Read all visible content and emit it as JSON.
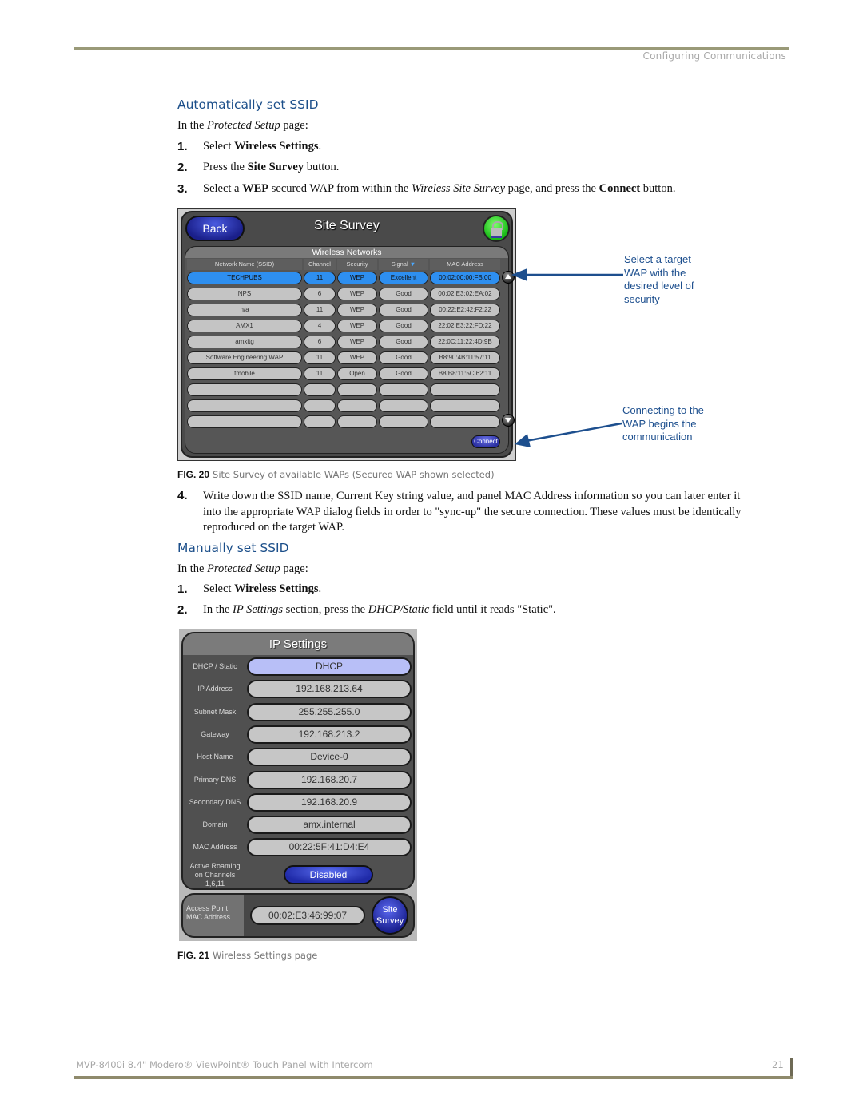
{
  "header": {
    "section": "Configuring Communications"
  },
  "auto": {
    "heading": "Automatically set SSID",
    "intro": {
      "pre": "In the ",
      "em": "Protected Setup",
      "post": " page:"
    },
    "steps": [
      {
        "num": "1.",
        "parts": [
          "Select ",
          "Wireless Settings",
          "."
        ]
      },
      {
        "num": "2.",
        "parts": [
          "Press the ",
          "Site Survey",
          " button."
        ]
      },
      {
        "num": "3.",
        "parts": [
          "Select a ",
          "WEP",
          " secured WAP from within the ",
          "Wireless Site Survey",
          " page, and press the ",
          "Connect",
          " button."
        ]
      }
    ]
  },
  "site_survey": {
    "back_label": "Back",
    "title": "Site Survey",
    "lock_icon": "lock-icon",
    "section_title": "Wireless Networks",
    "columns": [
      "Network Name (SSID)",
      "Channel",
      "Security",
      "Signal",
      "MAC Address"
    ],
    "sort_icon": "sort-down-icon",
    "rows": [
      {
        "ssid": "TECHPUBS",
        "channel": "11",
        "security": "WEP",
        "signal": "Excellent",
        "mac": "00:02:00:00:FB:00",
        "selected": true
      },
      {
        "ssid": "NPS",
        "channel": "6",
        "security": "WEP",
        "signal": "Good",
        "mac": "00:02:E3:02:EA:02"
      },
      {
        "ssid": "n/a",
        "channel": "11",
        "security": "WEP",
        "signal": "Good",
        "mac": "00:22:E2:42:F2:22"
      },
      {
        "ssid": "AMX1",
        "channel": "4",
        "security": "WEP",
        "signal": "Good",
        "mac": "22:02:E3:22:FD:22"
      },
      {
        "ssid": "amxitg",
        "channel": "6",
        "security": "WEP",
        "signal": "Good",
        "mac": "22:0C:11:22:4D:9B"
      },
      {
        "ssid": "Software Engineering WAP",
        "channel": "11",
        "security": "WEP",
        "signal": "Good",
        "mac": "B8:90:4B:11:57:11"
      },
      {
        "ssid": "tmobile",
        "channel": "11",
        "security": "Open",
        "signal": "Good",
        "mac": "B8:B8:11:5C:62:11"
      },
      {
        "ssid": "",
        "channel": "",
        "security": "",
        "signal": "",
        "mac": ""
      },
      {
        "ssid": "",
        "channel": "",
        "security": "",
        "signal": "",
        "mac": ""
      },
      {
        "ssid": "",
        "channel": "",
        "security": "",
        "signal": "",
        "mac": ""
      }
    ],
    "connect_label": "Connect"
  },
  "callouts": {
    "select": [
      "Select a target",
      "WAP with the",
      "desired level of",
      "security"
    ],
    "connect": [
      "Connecting to the",
      "WAP begins the",
      "communication"
    ]
  },
  "fig20": {
    "label": "FIG. 20",
    "text": "Site Survey of available WAPs (Secured WAP shown selected)"
  },
  "step4": {
    "num": "4.",
    "lines": [
      "Write down the SSID name, Current Key string value, and panel MAC Address information so you can later enter it",
      "into the appropriate WAP dialog fields in order to \"sync-up\" the secure connection. These values must be identically",
      "reproduced on the target WAP."
    ]
  },
  "manual": {
    "heading": "Manually set SSID",
    "intro": {
      "pre": "In the ",
      "em": "Protected Setup",
      "post": " page:"
    },
    "steps": [
      {
        "num": "1.",
        "parts": [
          "Select ",
          "Wireless Settings",
          "."
        ]
      },
      {
        "num": "2.",
        "parts": [
          "In the ",
          "IP Settings",
          " section, press the ",
          "DHCP/Static",
          " field until it reads \"Static\"."
        ]
      }
    ]
  },
  "ip_settings": {
    "title": "IP Settings",
    "fields": [
      {
        "label": "DHCP / Static",
        "value": "DHCP",
        "highlight": true
      },
      {
        "label": "IP Address",
        "value": "192.168.213.64"
      },
      {
        "label": "Subnet Mask",
        "value": "255.255.255.0"
      },
      {
        "label": "Gateway",
        "value": "192.168.213.2"
      },
      {
        "label": "Host Name",
        "value": "Device-0"
      },
      {
        "label": "Primary DNS",
        "value": "192.168.20.7"
      },
      {
        "label": "Secondary DNS",
        "value": "192.168.20.9"
      },
      {
        "label": "Domain",
        "value": "amx.internal"
      },
      {
        "label": "MAC Address",
        "value": "00:22:5F:41:D4:E4"
      }
    ],
    "roaming_label": [
      "Active Roaming",
      "on Channels",
      "1,6,11"
    ],
    "roaming_value": "Disabled",
    "ap_label": [
      "Access Point",
      "MAC Address"
    ],
    "ap_value": "00:02:E3:46:99:07",
    "site_survey_label": [
      "Site",
      "Survey"
    ]
  },
  "fig21": {
    "label": "FIG. 21",
    "text": "Wireless Settings page"
  },
  "footer": {
    "title": "MVP-8400i 8.4\" Modero® ViewPoint® Touch Panel with Intercom",
    "page": "21"
  },
  "colors": {
    "heading": "#1c4f8a",
    "callout": "#1d4f8e",
    "selected_row": "#2e8ff0",
    "rule": "#9a9a78"
  }
}
